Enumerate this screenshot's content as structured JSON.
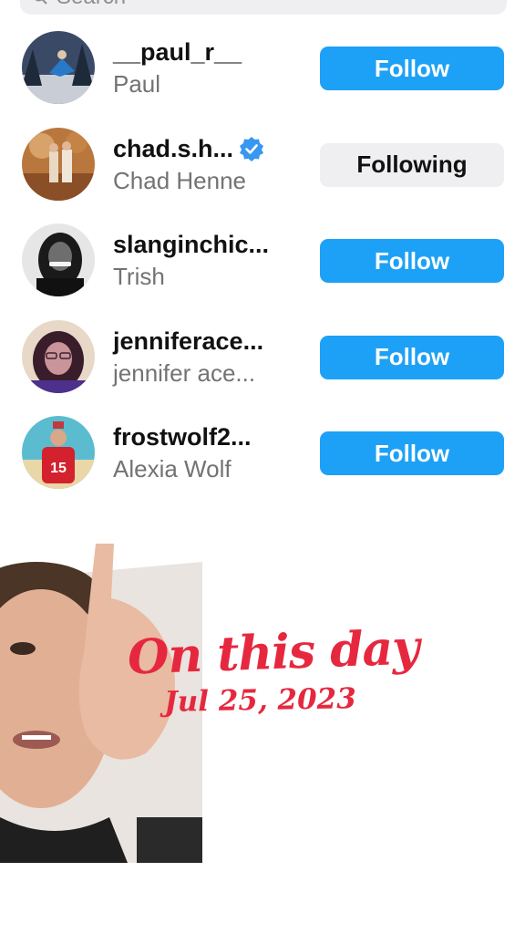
{
  "search": {
    "placeholder": "Search"
  },
  "users": [
    {
      "username": "__paul_r__",
      "fullname": "Paul",
      "button": "Follow",
      "state": "follow",
      "verified": false
    },
    {
      "username": "chad.s.h...",
      "fullname": "Chad Henne",
      "button": "Following",
      "state": "following",
      "verified": true
    },
    {
      "username": "slanginchic...",
      "fullname": "Trish",
      "button": "Follow",
      "state": "follow",
      "verified": false
    },
    {
      "username": "jenniferace...",
      "fullname": "jennifer ace...",
      "button": "Follow",
      "state": "follow",
      "verified": false
    },
    {
      "username": "frostwolf2...",
      "fullname": "Alexia Wolf",
      "button": "Follow",
      "state": "follow",
      "verified": false
    }
  ],
  "memory": {
    "title": "On this day",
    "date": "Jul 25, 2023"
  },
  "colors": {
    "follow_blue": "#1da1f7",
    "following_gray": "#efeff1",
    "memory_red": "#e6283f",
    "verified_blue": "#3897f0"
  }
}
